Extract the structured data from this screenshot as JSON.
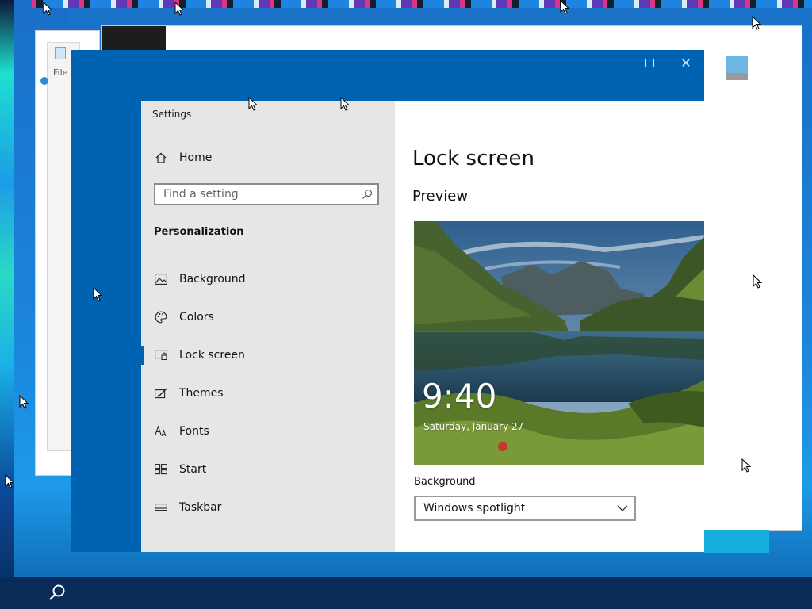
{
  "background_windows": {
    "file_label": "File"
  },
  "settings": {
    "app_title": "Settings",
    "home_label": "Home",
    "search": {
      "placeholder": "Find a setting"
    },
    "section_title": "Personalization",
    "nav_items": [
      {
        "label": "Background",
        "icon": "picture-icon"
      },
      {
        "label": "Colors",
        "icon": "palette-icon"
      },
      {
        "label": "Lock screen",
        "icon": "lock-screen-icon",
        "selected": true
      },
      {
        "label": "Themes",
        "icon": "themes-icon"
      },
      {
        "label": "Fonts",
        "icon": "fonts-icon"
      },
      {
        "label": "Start",
        "icon": "start-icon"
      },
      {
        "label": "Taskbar",
        "icon": "taskbar-icon"
      }
    ]
  },
  "content": {
    "page_title": "Lock screen",
    "preview_title": "Preview",
    "preview": {
      "time": "9:40",
      "date": "Saturday, January 27"
    },
    "background_label": "Background",
    "background_value": "Windows spotlight"
  },
  "colors": {
    "accent": "#0063b1",
    "sidebar": "#e6e6e6",
    "content": "#ffffff",
    "taskbar": "#082b57"
  }
}
